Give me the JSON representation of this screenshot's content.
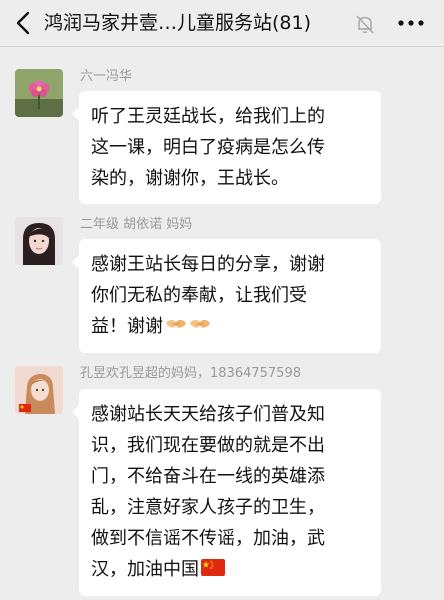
{
  "header": {
    "title": "鸿润马家井壹…儿童服务站(81)"
  },
  "messages": [
    {
      "sender": "六一冯华",
      "lines": [
        "听了王灵廷战长，给我们上的",
        "这一课，明白了疫病是怎么传",
        "染的，谢谢你，王战长。"
      ]
    },
    {
      "sender": "二年级 胡依诺 妈妈",
      "lines": [
        "感谢王站长每日的分享，谢谢",
        "你们无私的奉献，让我们受",
        "益！谢谢"
      ],
      "emojis": [
        "handshake",
        "handshake"
      ]
    },
    {
      "sender": "孔昱欢孔昱超的妈妈，18364757598",
      "lines": [
        "感谢站长天天给孩子们普及知",
        "识，我们现在要做的就是不出",
        "门，不给奋斗在一线的英雄添",
        "乱，注意好家人孩子的卫生，",
        "做到不信谣不传谣，加油，武",
        "汉，加油中国"
      ],
      "emojis": [
        "china-flag"
      ]
    }
  ]
}
